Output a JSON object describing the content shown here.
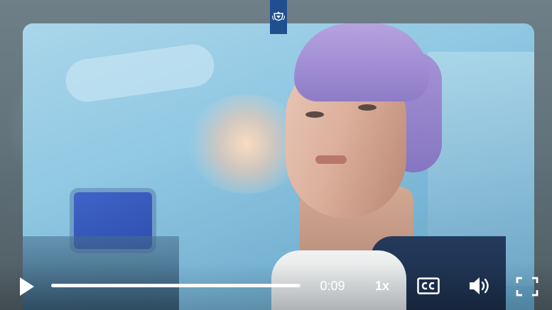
{
  "player": {
    "emblem_icon": "royal-coat-of-arms-icon",
    "video": {
      "elapsed_time": "0:09",
      "progress_percent": 99.5,
      "playback_speed": "1x"
    },
    "controls": {
      "play_icon": "play-icon",
      "captions_icon": "closed-captions-icon",
      "volume_icon": "volume-icon",
      "fullscreen_icon": "fullscreen-icon"
    },
    "colors": {
      "emblem_bg": "#1f4f8f",
      "controls_fg": "#ffffff"
    }
  }
}
